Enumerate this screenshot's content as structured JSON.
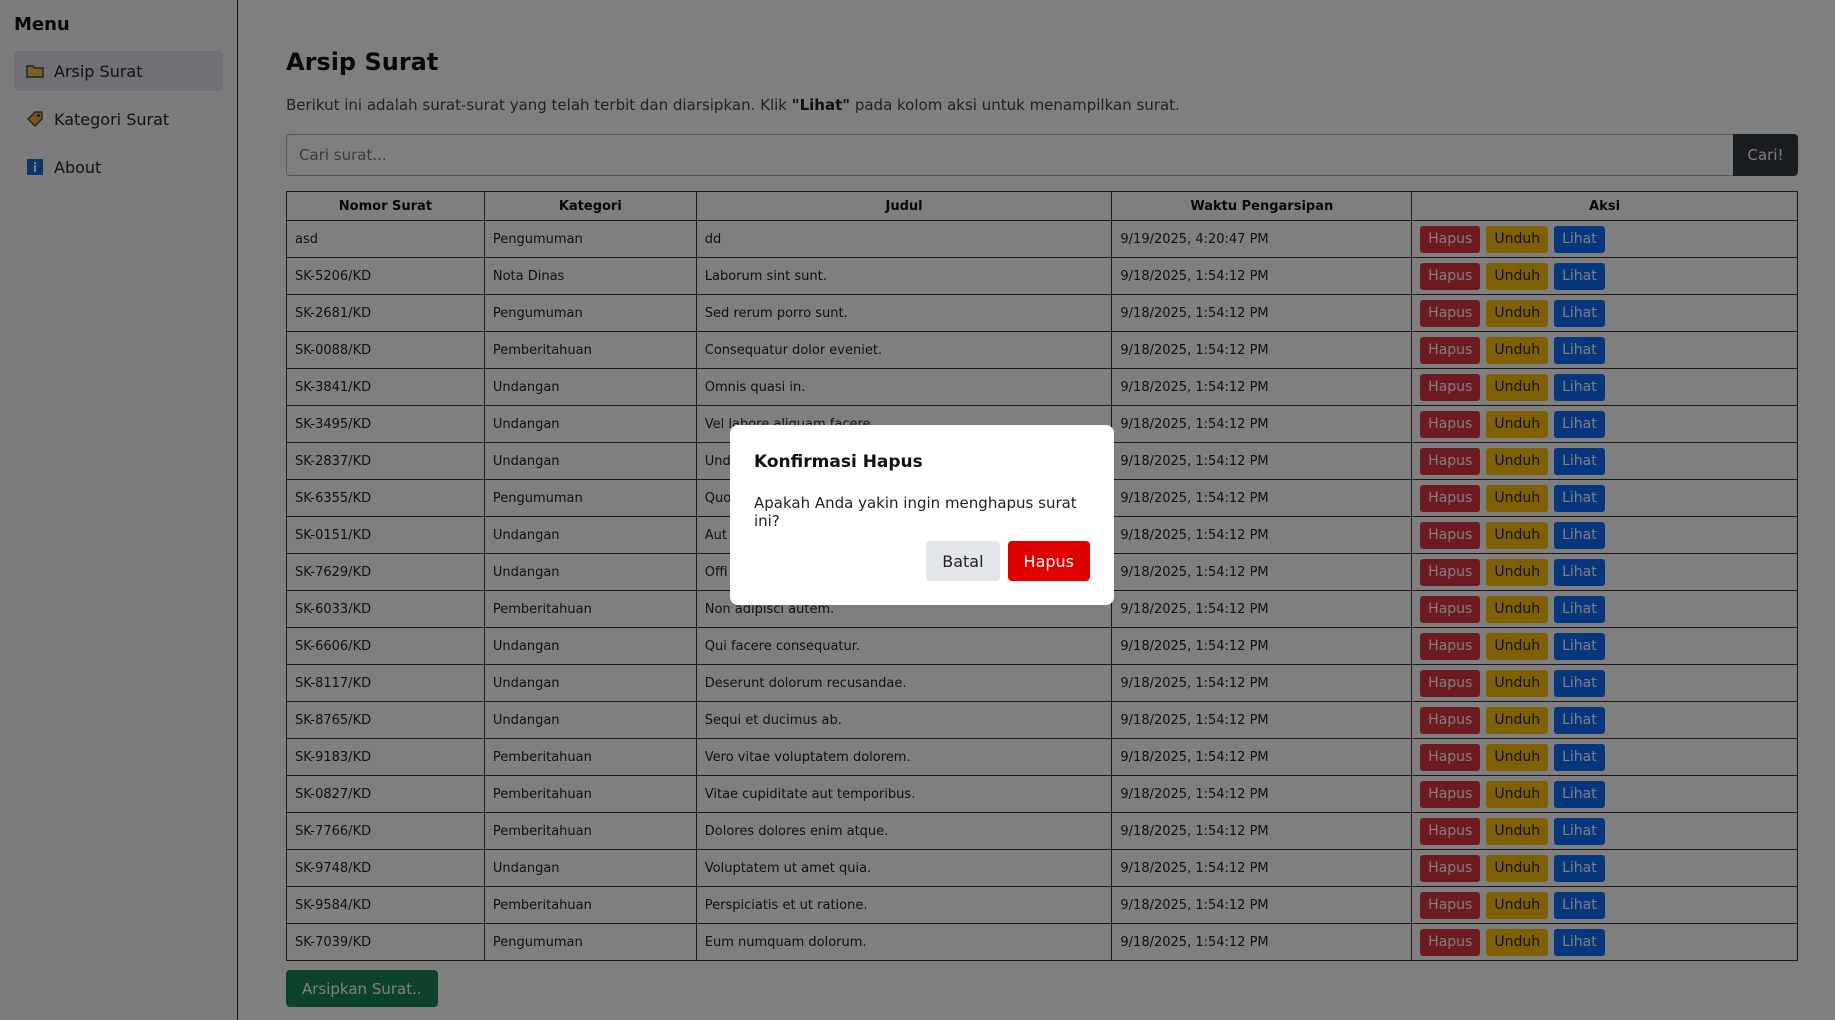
{
  "sidebar": {
    "title": "Menu",
    "items": [
      {
        "label": "Arsip Surat",
        "icon": "folder-icon"
      },
      {
        "label": "Kategori Surat",
        "icon": "tag-icon"
      },
      {
        "label": "About",
        "icon": "info-icon"
      }
    ]
  },
  "main": {
    "title": "Arsip Surat",
    "description_pre": "Berikut ini adalah surat-surat yang telah terbit dan diarsipkan. Klik ",
    "description_bold": "\"Lihat\"",
    "description_post": " pada kolom aksi untuk menampilkan surat.",
    "search_placeholder": "Cari surat...",
    "search_button": "Cari!",
    "archive_button": "Arsipkan Surat.."
  },
  "table": {
    "headers": [
      "Nomor Surat",
      "Kategori",
      "Judul",
      "Waktu Pengarsipan",
      "Aksi"
    ],
    "action_labels": {
      "delete": "Hapus",
      "download": "Unduh",
      "view": "Lihat"
    },
    "rows": [
      [
        "asd",
        "Pengumuman",
        "dd",
        "9/19/2025, 4:20:47 PM"
      ],
      [
        "SK-5206/KD",
        "Nota Dinas",
        "Laborum sint sunt.",
        "9/18/2025, 1:54:12 PM"
      ],
      [
        "SK-2681/KD",
        "Pengumuman",
        "Sed rerum porro sunt.",
        "9/18/2025, 1:54:12 PM"
      ],
      [
        "SK-0088/KD",
        "Pemberitahuan",
        "Consequatur dolor eveniet.",
        "9/18/2025, 1:54:12 PM"
      ],
      [
        "SK-3841/KD",
        "Undangan",
        "Omnis quasi in.",
        "9/18/2025, 1:54:12 PM"
      ],
      [
        "SK-3495/KD",
        "Undangan",
        "Vel labore aliquam facere.",
        "9/18/2025, 1:54:12 PM"
      ],
      [
        "SK-2837/KD",
        "Undangan",
        "Und",
        "9/18/2025, 1:54:12 PM"
      ],
      [
        "SK-6355/KD",
        "Pengumuman",
        "Quo",
        "9/18/2025, 1:54:12 PM"
      ],
      [
        "SK-0151/KD",
        "Undangan",
        "Aut",
        "9/18/2025, 1:54:12 PM"
      ],
      [
        "SK-7629/KD",
        "Undangan",
        "Offi",
        "9/18/2025, 1:54:12 PM"
      ],
      [
        "SK-6033/KD",
        "Pemberitahuan",
        "Non adipisci autem.",
        "9/18/2025, 1:54:12 PM"
      ],
      [
        "SK-6606/KD",
        "Undangan",
        "Qui facere consequatur.",
        "9/18/2025, 1:54:12 PM"
      ],
      [
        "SK-8117/KD",
        "Undangan",
        "Deserunt dolorum recusandae.",
        "9/18/2025, 1:54:12 PM"
      ],
      [
        "SK-8765/KD",
        "Undangan",
        "Sequi et ducimus ab.",
        "9/18/2025, 1:54:12 PM"
      ],
      [
        "SK-9183/KD",
        "Pemberitahuan",
        "Vero vitae voluptatem dolorem.",
        "9/18/2025, 1:54:12 PM"
      ],
      [
        "SK-0827/KD",
        "Pemberitahuan",
        "Vitae cupiditate aut temporibus.",
        "9/18/2025, 1:54:12 PM"
      ],
      [
        "SK-7766/KD",
        "Pemberitahuan",
        "Dolores dolores enim atque.",
        "9/18/2025, 1:54:12 PM"
      ],
      [
        "SK-9748/KD",
        "Undangan",
        "Voluptatem ut amet quia.",
        "9/18/2025, 1:54:12 PM"
      ],
      [
        "SK-9584/KD",
        "Pemberitahuan",
        "Perspiciatis et ut ratione.",
        "9/18/2025, 1:54:12 PM"
      ],
      [
        "SK-7039/KD",
        "Pengumuman",
        "Eum numquam dolorum.",
        "9/18/2025, 1:54:12 PM"
      ]
    ]
  },
  "modal": {
    "title": "Konfirmasi Hapus",
    "message": "Apakah Anda yakin ingin menghapus surat ini?",
    "cancel_label": "Batal",
    "confirm_label": "Hapus"
  },
  "colors": {
    "delete": "#dc3545",
    "download": "#ffc107",
    "view": "#0d6efd",
    "archive": "#198754",
    "confirm": "#e00000"
  }
}
